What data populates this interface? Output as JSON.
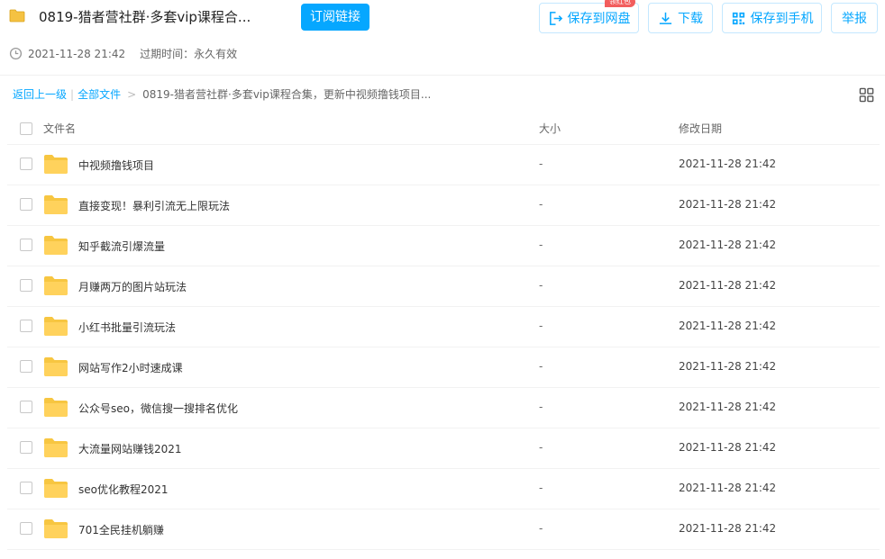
{
  "header": {
    "title": "0819-猎者营社群·多套vip课程合...",
    "subscribe_label": "订阅链接",
    "save_label": "保存到网盘",
    "save_badge": "领红包",
    "download_label": "下载",
    "save_phone_label": "保存到手机",
    "report_label": "举报",
    "accent_color": "#06a7ff"
  },
  "meta": {
    "created": "2021-11-28 21:42",
    "expire_label": "过期时间：永久有效"
  },
  "breadcrumb": {
    "back": "返回上一级",
    "separator": "|",
    "all_files": "全部文件",
    "arrow": ">",
    "current": "0819-猎者营社群·多套vip课程合集，更新中视频撸钱项目..."
  },
  "table": {
    "headers": {
      "name": "文件名",
      "size": "大小",
      "date": "修改日期"
    },
    "rows": [
      {
        "name": "中视频撸钱项目",
        "size": "-",
        "date": "2021-11-28 21:42"
      },
      {
        "name": "直接变现！暴利引流无上限玩法",
        "size": "-",
        "date": "2021-11-28 21:42"
      },
      {
        "name": "知乎截流引爆流量",
        "size": "-",
        "date": "2021-11-28 21:42"
      },
      {
        "name": "月赚两万的图片站玩法",
        "size": "-",
        "date": "2021-11-28 21:42"
      },
      {
        "name": "小红书批量引流玩法",
        "size": "-",
        "date": "2021-11-28 21:42"
      },
      {
        "name": "网站写作2小时速成课",
        "size": "-",
        "date": "2021-11-28 21:42"
      },
      {
        "name": "公众号seo，微信搜一搜排名优化",
        "size": "-",
        "date": "2021-11-28 21:42"
      },
      {
        "name": "大流量网站赚钱2021",
        "size": "-",
        "date": "2021-11-28 21:42"
      },
      {
        "name": "seo优化教程2021",
        "size": "-",
        "date": "2021-11-28 21:42"
      },
      {
        "name": "701全民挂机躺赚",
        "size": "-",
        "date": "2021-11-28 21:42"
      }
    ]
  }
}
